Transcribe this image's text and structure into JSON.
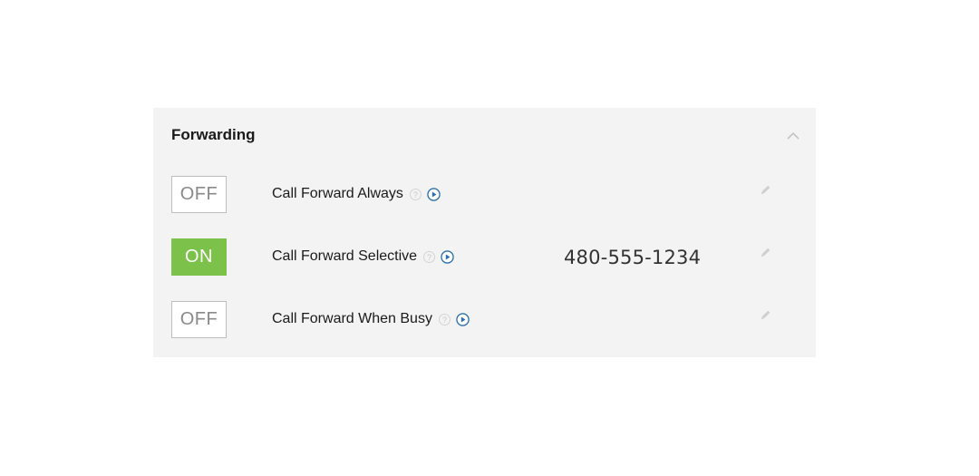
{
  "panel": {
    "title": "Forwarding",
    "collapse_icon": "chevron-up-icon"
  },
  "rows": [
    {
      "toggle": "OFF",
      "label": "Call Forward Always",
      "help_icon": "help-icon",
      "help_glyph": "?",
      "play_icon": "play-circle-icon",
      "phone": "",
      "edit_icon": "pencil-icon"
    },
    {
      "toggle": "ON",
      "label": "Call Forward Selective",
      "help_icon": "help-icon",
      "help_glyph": "?",
      "play_icon": "play-circle-icon",
      "phone": "480-555-1234",
      "edit_icon": "pencil-icon"
    },
    {
      "toggle": "OFF",
      "label": "Call Forward When Busy",
      "help_icon": "help-icon",
      "help_glyph": "?",
      "play_icon": "play-circle-icon",
      "phone": "",
      "edit_icon": "pencil-icon"
    }
  ],
  "colors": {
    "toggle_on_bg": "#7cc24a",
    "play_icon": "#2a6fb0",
    "panel_bg": "#f3f3f3"
  }
}
